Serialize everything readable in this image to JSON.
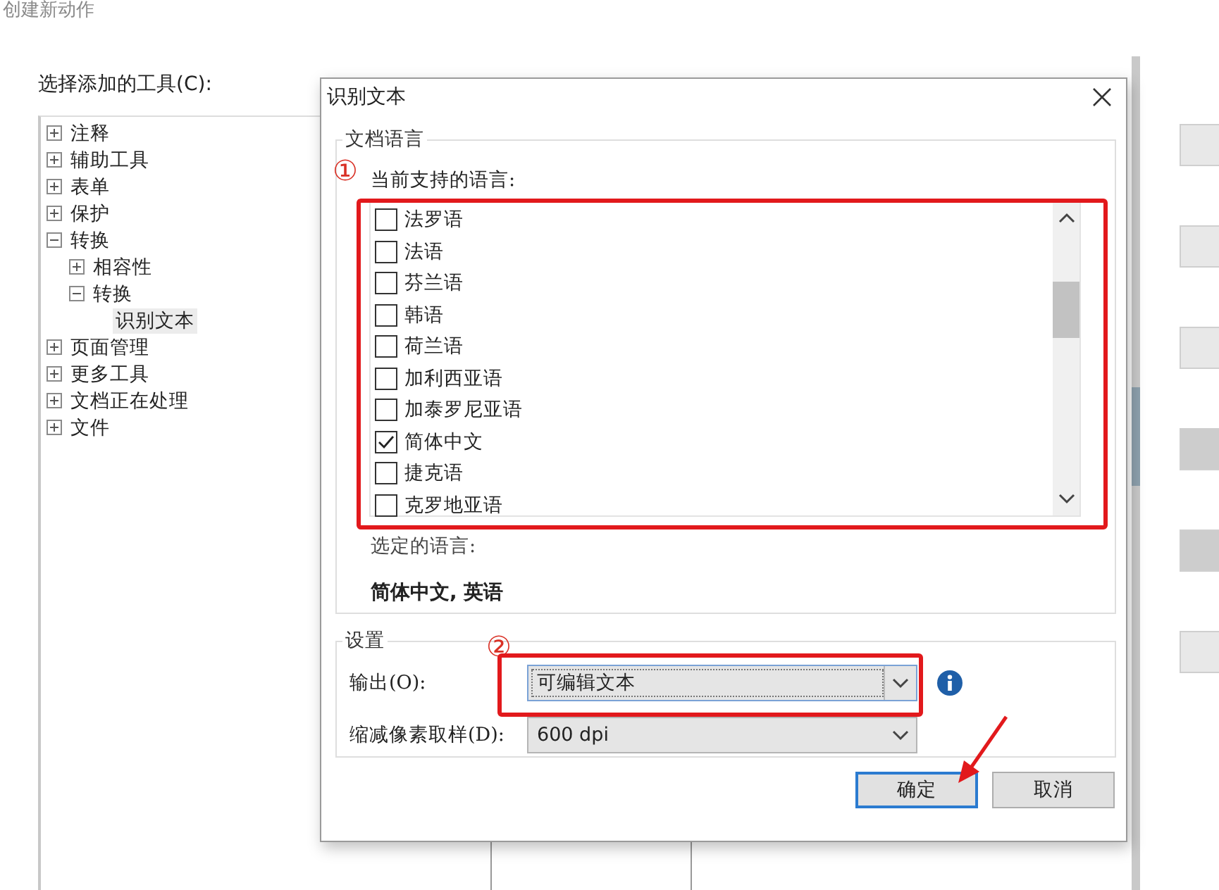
{
  "window": {
    "title": "创建新动作"
  },
  "tools_label": "选择添加的工具(C):",
  "tool_tree": [
    {
      "label": "注释",
      "expanded": false,
      "selected": false
    },
    {
      "label": "辅助工具",
      "expanded": false,
      "selected": false
    },
    {
      "label": "表单",
      "expanded": false,
      "selected": false
    },
    {
      "label": "保护",
      "expanded": false,
      "selected": false
    },
    {
      "label": "转换",
      "expanded": true,
      "selected": false,
      "children": [
        {
          "label": "相容性",
          "expanded": false,
          "selected": false
        },
        {
          "label": "转换",
          "expanded": true,
          "selected": false,
          "children": [
            {
              "label": "识别文本",
              "selected": true
            }
          ]
        }
      ]
    },
    {
      "label": "页面管理",
      "expanded": false,
      "selected": false
    },
    {
      "label": "更多工具",
      "expanded": false,
      "selected": false
    },
    {
      "label": "文档正在处理",
      "expanded": false,
      "selected": false
    },
    {
      "label": "文件",
      "expanded": false,
      "selected": false
    }
  ],
  "side_buttons": [
    {
      "disabled": false
    },
    {
      "disabled": false
    },
    {
      "disabled": false
    },
    {
      "disabled": true
    },
    {
      "disabled": true
    },
    {
      "disabled": false
    }
  ],
  "dialog": {
    "title": "识别文本",
    "language_group": {
      "title": "文档语言",
      "marker": "①",
      "label": "当前支持的语言:",
      "languages": [
        {
          "label": "法罗语",
          "checked": false
        },
        {
          "label": "法语",
          "checked": false
        },
        {
          "label": "芬兰语",
          "checked": false
        },
        {
          "label": "韩语",
          "checked": false
        },
        {
          "label": "荷兰语",
          "checked": false
        },
        {
          "label": "加利西亚语",
          "checked": false
        },
        {
          "label": "加泰罗尼亚语",
          "checked": false
        },
        {
          "label": "简体中文",
          "checked": true
        },
        {
          "label": "捷克语",
          "checked": false
        },
        {
          "label": "克罗地亚语",
          "checked": false
        }
      ],
      "selected_label": "选定的语言:",
      "selected_value": "简体中文, 英语"
    },
    "settings_group": {
      "title": "设置",
      "marker": "②",
      "output": {
        "label": "输出(O):",
        "value": "可编辑文本"
      },
      "downsample": {
        "label": "缩减像素取样(D):",
        "value": "600 dpi"
      }
    },
    "buttons": [
      {
        "label": "确定",
        "default": true
      },
      {
        "label": "取消",
        "default": false
      }
    ]
  }
}
